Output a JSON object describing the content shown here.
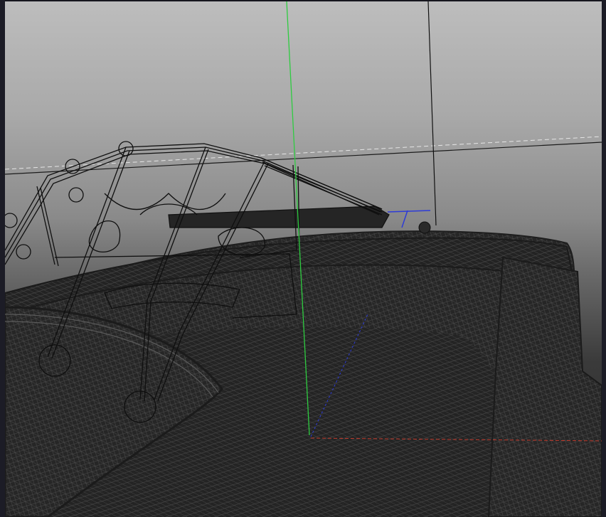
{
  "viewport": {
    "view": "perspective",
    "display_mode": "wireframe",
    "background_gradient": [
      "#bdbdbd",
      "#8a8a8a",
      "#2a2a2a"
    ],
    "wire_color": "#222222",
    "axes": {
      "x_color": "#c0392b",
      "y_color": "#2ecc40",
      "z_color": "#2d3bd8"
    },
    "manipulator_color": "#2d3bd8",
    "horizon_line_color": "#e6e6e6",
    "crosshair_color": "#111111"
  }
}
